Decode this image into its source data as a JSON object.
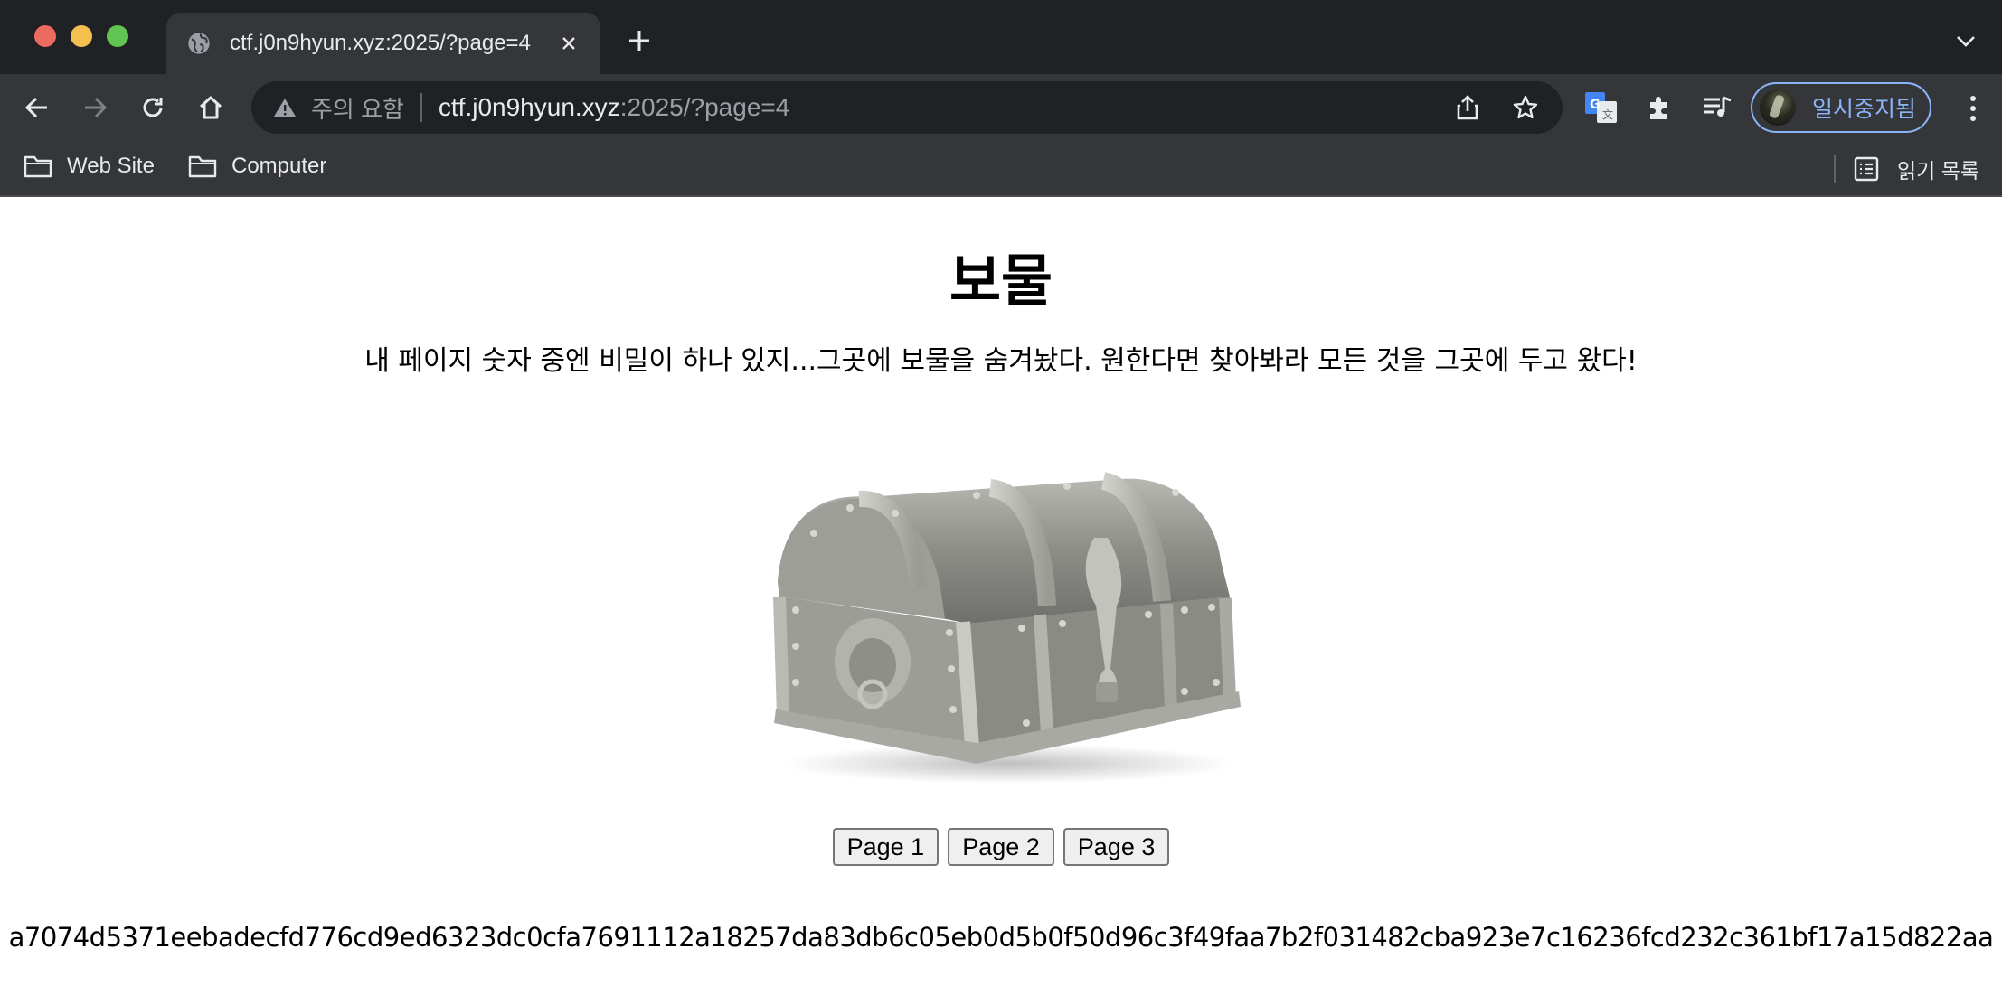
{
  "browser": {
    "tab": {
      "title": "ctf.j0n9hyun.xyz:2025/?page=4"
    },
    "address_bar": {
      "security_label": "주의 요함",
      "url_host": "ctf.j0n9hyun.xyz",
      "url_rest": ":2025/?page=4"
    },
    "profile": {
      "label": "일시중지됨"
    },
    "bookmarks": [
      {
        "label": "Web Site"
      },
      {
        "label": "Computer"
      }
    ],
    "reading_list": {
      "label": "읽기 목록"
    }
  },
  "page": {
    "title": "보물",
    "description": "내 페이지 숫자 중엔 비밀이 하나 있지...그곳에 보물을 숨겨놨다. 원한다면 찾아봐라 모든 것을 그곳에 두고 왔다!",
    "buttons": [
      {
        "label": "Page 1"
      },
      {
        "label": "Page 2"
      },
      {
        "label": "Page 3"
      }
    ],
    "hash": "a7074d5371eebadecfd776cd9ed6323dc0cfa7691112a18257da83db6c05eb0d5b0f50d96c3f49faa7b2f031482cba923e7c16236fcd232c361bf17a15d822aa"
  }
}
